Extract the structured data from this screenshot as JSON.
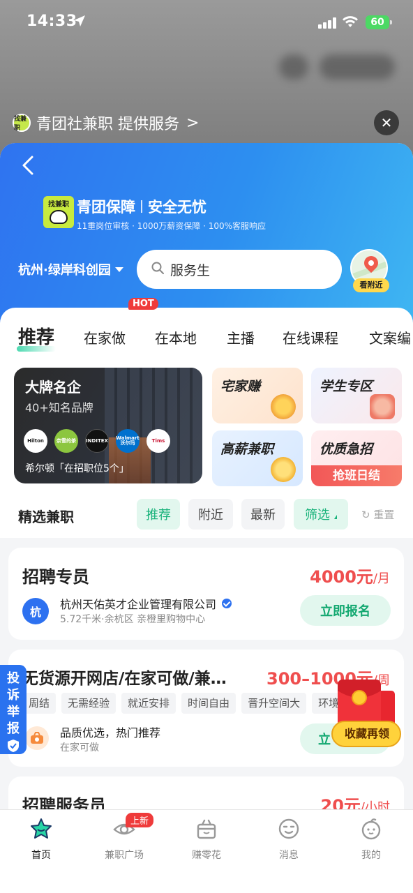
{
  "status_bar": {
    "time": "14:33",
    "battery": "60"
  },
  "provider": {
    "logo_text": "找兼职",
    "text": "青团社兼职 提供服务",
    "chevron": ">"
  },
  "close": "✕",
  "brand": {
    "logo_text": "找兼职",
    "title_a": "青团保障",
    "title_b": "安全无忧",
    "subtitle": "11重岗位审核 · 1000万薪资保障 · 100%客服响应"
  },
  "location": "杭州·绿岸科创园",
  "search": {
    "value": "服务生"
  },
  "nearby_label": "看附近",
  "tabs": [
    "推荐",
    "在家做",
    "在本地",
    "主播",
    "在线课程",
    "文案编"
  ],
  "hot_badge": "HOT",
  "brand_card": {
    "title": "大牌名企",
    "subtitle": "40+知名品牌",
    "logos": [
      "Hilton",
      "奈雪的茶",
      "INDITEX",
      "Walmart 沃尔玛",
      "Tims"
    ],
    "footer": "希尔顿「在招职位5个」"
  },
  "mini_cards": [
    {
      "title": "宅家赚"
    },
    {
      "title": "学生专区"
    },
    {
      "title": "高薪兼职"
    },
    {
      "title": "优质急招",
      "banner": "抢班日结"
    }
  ],
  "filter": {
    "heading": "精选兼职",
    "chips": [
      "推荐",
      "附近",
      "最新",
      "筛选"
    ],
    "reset": "重置"
  },
  "jobs": [
    {
      "title": "招聘专员",
      "salary": "4000元",
      "unit": "/月",
      "company_icon": "杭",
      "company": "杭州天佑英才企业管理有限公司",
      "location": "5.72千米·余杭区 亲橙里购物中心",
      "apply": "立即报名"
    },
    {
      "title": "无货源开网店/在家可做/兼…",
      "salary": "300–1000元",
      "unit": "/周",
      "tags": [
        "周结",
        "无需经验",
        "就近安排",
        "时间自由",
        "晋升空间大",
        "环境"
      ],
      "note": "品质优选，热门推荐",
      "sub": "在家可做",
      "apply": "立"
    },
    {
      "title": "招聘服务员",
      "salary": "20元",
      "unit": "/小时"
    }
  ],
  "complaint": "投诉举报",
  "redpacket_label": "收藏再领",
  "bottom_nav": [
    "首页",
    "兼职广场",
    "赚零花",
    "消息",
    "我的"
  ],
  "new_badge": "上新",
  "colors": {
    "primary_blue": "#2f73f0",
    "accent_green": "#18b27a",
    "price_red": "#ef4e4e"
  }
}
